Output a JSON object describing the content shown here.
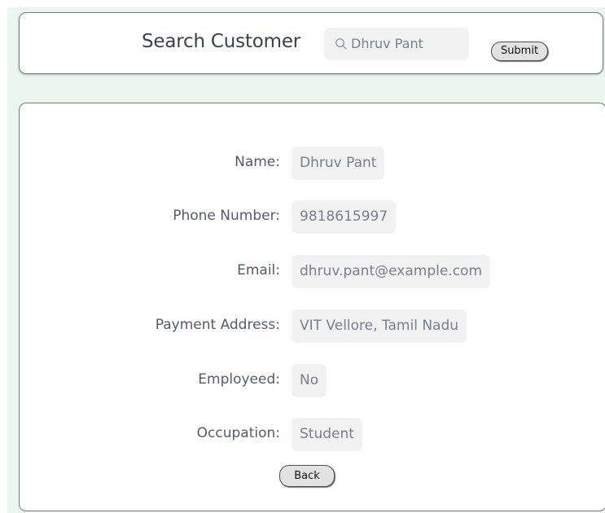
{
  "search": {
    "title": "Search Customer",
    "input_value": "Dhruv Pant",
    "submit_label": "Submit"
  },
  "customer": {
    "fields": [
      {
        "label": "Name:",
        "value": "Dhruv Pant"
      },
      {
        "label": "Phone Number:",
        "value": "9818615997"
      },
      {
        "label": "Email:",
        "value": "dhruv.pant@example.com"
      },
      {
        "label": "Payment Address:",
        "value": "VIT Vellore, Tamil Nadu"
      },
      {
        "label": "Employeed:",
        "value": "No"
      },
      {
        "label": "Occupation:",
        "value": "Student"
      }
    ],
    "back_label": "Back"
  },
  "colors": {
    "page_background": "#ecf6f1",
    "card_background": "#ffffff",
    "field_background": "#f2f2f2",
    "button_background": "#e2e2e2"
  },
  "icons": {
    "search": "search-icon"
  }
}
